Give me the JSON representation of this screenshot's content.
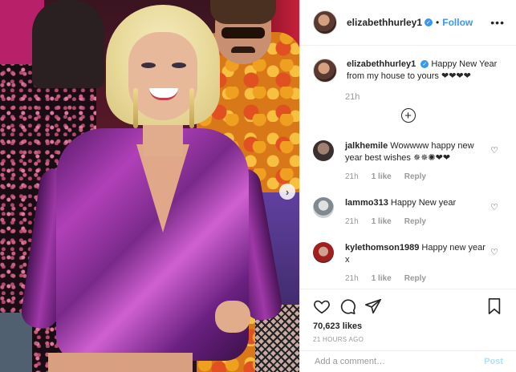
{
  "post": {
    "username": "elizabethhurley1",
    "follow_label": "Follow",
    "dot": "•",
    "more_icon": "•••"
  },
  "caption": {
    "username": "elizabethhurley1",
    "text": "Happy New Year from my house to yours ❤❤❤❤",
    "time": "21h"
  },
  "comments": [
    {
      "username": "jalkhemile",
      "text": "Wowwww happy new year best wishes ✵✵✺❤❤",
      "time": "21h",
      "likes": "1 like",
      "reply": "Reply"
    },
    {
      "username": "lammo313",
      "text": "Happy New year",
      "time": "21h",
      "likes": "1 like",
      "reply": "Reply"
    },
    {
      "username": "kylethomson1989",
      "text": "Happy new year x",
      "time": "21h",
      "likes": "1 like",
      "reply": "Reply"
    }
  ],
  "stats": {
    "likes": "70,623 likes",
    "posted": "21 HOURS AGO"
  },
  "add_comment": {
    "placeholder": "Add a comment…",
    "post_label": "Post"
  },
  "colors": {
    "link": "#3897f0",
    "muted": "#999999",
    "post_disabled": "#b2dffc"
  }
}
